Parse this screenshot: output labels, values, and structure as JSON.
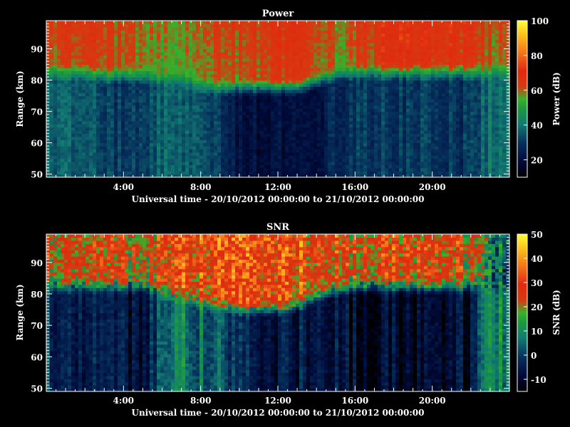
{
  "chart_data": [
    {
      "type": "heatmap",
      "title": "Power",
      "xlabel": "Universal time - 20/10/2012 00:00:00 to 21/10/2012 00:00:00",
      "ylabel": "Range (km)",
      "colorbar_label": "Power (dB)",
      "x_tick_labels": [
        "4:00",
        "8:00",
        "12:00",
        "16:00",
        "20:00"
      ],
      "x_ticks_hours": [
        4,
        8,
        12,
        16,
        20
      ],
      "xlim_hours": [
        0,
        24
      ],
      "y_tick_labels": [
        "50",
        "60",
        "70",
        "80",
        "90"
      ],
      "y_ticks": [
        50,
        60,
        70,
        80,
        90
      ],
      "ylim": [
        49,
        99
      ],
      "colorbar_tick_labels": [
        "20",
        "40",
        "60",
        "80",
        "100"
      ],
      "colorbar_ticks": [
        20,
        40,
        60,
        80,
        100
      ],
      "colorbar_range": [
        10,
        100
      ],
      "time_hours": [
        0,
        1,
        2,
        3,
        4,
        5,
        6,
        7,
        8,
        9,
        10,
        11,
        12,
        13,
        14,
        15,
        16,
        17,
        18,
        19,
        20,
        21,
        22,
        23,
        24
      ],
      "upper_range": [
        60,
        62,
        63,
        62,
        60,
        58,
        56,
        56,
        58,
        60,
        61,
        62,
        63,
        64,
        62,
        58,
        60,
        64,
        70,
        66,
        64,
        66,
        64,
        60,
        60
      ],
      "transition_km": [
        82,
        82,
        82,
        81,
        81,
        81,
        80,
        80,
        78,
        77,
        77,
        77,
        77,
        77,
        79,
        81,
        82,
        82,
        82,
        82,
        82,
        82,
        82,
        82,
        82
      ],
      "lower_range": [
        38,
        37,
        36,
        33,
        30,
        32,
        38,
        38,
        36,
        30,
        22,
        20,
        20,
        20,
        22,
        28,
        30,
        31,
        31,
        30,
        30,
        29,
        30,
        40,
        40
      ]
    },
    {
      "type": "heatmap",
      "title": "SNR",
      "xlabel": "Universal time - 20/10/2012 00:00:00 to 21/10/2012 00:00:00",
      "ylabel": "Range (km)",
      "colorbar_label": "SNR (dB)",
      "x_tick_labels": [
        "4:00",
        "8:00",
        "12:00",
        "16:00",
        "20:00"
      ],
      "x_ticks_hours": [
        4,
        8,
        12,
        16,
        20
      ],
      "xlim_hours": [
        0,
        24
      ],
      "y_tick_labels": [
        "50",
        "60",
        "70",
        "80",
        "90"
      ],
      "y_ticks": [
        50,
        60,
        70,
        80,
        90
      ],
      "ylim": [
        49,
        99
      ],
      "colorbar_tick_labels": [
        "-10",
        "0",
        "10",
        "20",
        "30",
        "40",
        "50"
      ],
      "colorbar_ticks": [
        -10,
        0,
        10,
        20,
        30,
        40,
        50
      ],
      "colorbar_range": [
        -15,
        50
      ],
      "time_hours": [
        0,
        1,
        2,
        3,
        4,
        5,
        6,
        7,
        8,
        9,
        10,
        11,
        12,
        13,
        14,
        15,
        16,
        17,
        18,
        19,
        20,
        21,
        22,
        23,
        24
      ],
      "upper_range": [
        22,
        24,
        24,
        22,
        21,
        20,
        26,
        28,
        29,
        30,
        30,
        30,
        30,
        29,
        27,
        24,
        24,
        26,
        28,
        26,
        25,
        24,
        22,
        5,
        5
      ],
      "transition_km": [
        82,
        82,
        82,
        82,
        82,
        82,
        80,
        79,
        77,
        76,
        75,
        75,
        75,
        76,
        79,
        81,
        82,
        82,
        82,
        82,
        82,
        82,
        82,
        82,
        82
      ],
      "lower_range": [
        0,
        -2,
        -4,
        -6,
        -8,
        -6,
        4,
        8,
        6,
        2,
        -4,
        -6,
        -6,
        -6,
        -4,
        -8,
        -9,
        -9,
        -9,
        -9,
        -9,
        -9,
        -8,
        10,
        10
      ]
    }
  ]
}
